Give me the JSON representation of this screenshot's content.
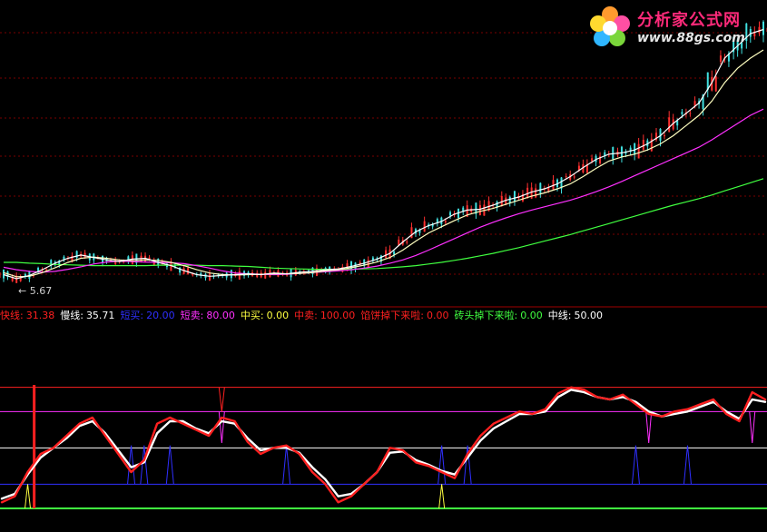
{
  "logo": {
    "brand": "分析家公式网",
    "url": "www.88gs.com"
  },
  "price_low_label": "← 5.67",
  "legend": [
    {
      "name": "快线",
      "value": "31.38",
      "color": "#ff2020"
    },
    {
      "name": "慢线",
      "value": "35.71",
      "color": "#ffffff"
    },
    {
      "name": "短买",
      "value": "20.00",
      "color": "#2f2fff"
    },
    {
      "name": "短卖",
      "value": "80.00",
      "color": "#ff30ff"
    },
    {
      "name": "中买",
      "value": "0.00",
      "color": "#ffff40"
    },
    {
      "name": "中卖",
      "value": "100.00",
      "color": "#ff2020"
    },
    {
      "name": "馅饼掉下来啦",
      "value": "0.00",
      "color": "#ff2020"
    },
    {
      "name": "砖头掉下来啦",
      "value": "0.00",
      "color": "#40ff40"
    },
    {
      "name": "中线",
      "value": "50.00",
      "color": "#ffffff"
    }
  ],
  "chart_data": [
    {
      "type": "line",
      "panel": "price",
      "x_count": 60,
      "series": [
        {
          "color": "#40ff40",
          "values": [
            6.3,
            6.3,
            6.28,
            6.27,
            6.25,
            6.24,
            6.23,
            6.22,
            6.22,
            6.22,
            6.22,
            6.22,
            6.23,
            6.23,
            6.23,
            6.23,
            6.22,
            6.22,
            6.21,
            6.2,
            6.18,
            6.16,
            6.15,
            6.14,
            6.13,
            6.13,
            6.13,
            6.13,
            6.14,
            6.15,
            6.17,
            6.19,
            6.22,
            6.26,
            6.3,
            6.35,
            6.4,
            6.46,
            6.52,
            6.59,
            6.66,
            6.74,
            6.82,
            6.9,
            6.98,
            7.07,
            7.16,
            7.25,
            7.34,
            7.43,
            7.52,
            7.61,
            7.7,
            7.78,
            7.86,
            7.95,
            8.05,
            8.15,
            8.25,
            8.35
          ]
        },
        {
          "color": "#ff30ff",
          "values": [
            6.18,
            6.12,
            6.08,
            6.06,
            6.08,
            6.13,
            6.19,
            6.26,
            6.31,
            6.33,
            6.32,
            6.31,
            6.3,
            6.29,
            6.27,
            6.22,
            6.16,
            6.09,
            6.04,
            6.02,
            6.01,
            6.0,
            6.01,
            6.03,
            6.05,
            6.07,
            6.09,
            6.12,
            6.16,
            6.21,
            6.28,
            6.36,
            6.47,
            6.6,
            6.74,
            6.88,
            7.02,
            7.16,
            7.28,
            7.39,
            7.49,
            7.58,
            7.66,
            7.74,
            7.82,
            7.92,
            8.03,
            8.15,
            8.28,
            8.42,
            8.56,
            8.7,
            8.84,
            8.98,
            9.12,
            9.3,
            9.5,
            9.7,
            9.9,
            10.05
          ]
        },
        {
          "color": "#ffffc0",
          "values": [
            6.05,
            5.95,
            5.96,
            6.05,
            6.17,
            6.3,
            6.4,
            6.43,
            6.4,
            6.36,
            6.34,
            6.36,
            6.35,
            6.3,
            6.22,
            6.12,
            6.04,
            6.0,
            5.99,
            6.0,
            6.01,
            6.02,
            6.02,
            6.03,
            6.05,
            6.09,
            6.12,
            6.17,
            6.23,
            6.31,
            6.42,
            6.6,
            6.82,
            7.02,
            7.17,
            7.32,
            7.46,
            7.55,
            7.62,
            7.72,
            7.82,
            7.92,
            8.0,
            8.1,
            8.22,
            8.4,
            8.6,
            8.78,
            8.88,
            8.95,
            9.05,
            9.2,
            9.4,
            9.65,
            9.9,
            10.25,
            10.7,
            11.05,
            11.3,
            11.5
          ]
        },
        {
          "color": "#ffffff",
          "values": [
            6.0,
            5.9,
            5.98,
            6.12,
            6.28,
            6.4,
            6.48,
            6.42,
            6.36,
            6.32,
            6.38,
            6.4,
            6.3,
            6.22,
            6.1,
            6.0,
            5.96,
            5.98,
            6.0,
            6.02,
            6.0,
            6.04,
            6.02,
            6.06,
            6.08,
            6.12,
            6.14,
            6.2,
            6.28,
            6.38,
            6.52,
            6.8,
            7.05,
            7.2,
            7.3,
            7.48,
            7.58,
            7.6,
            7.7,
            7.82,
            7.9,
            8.02,
            8.1,
            8.22,
            8.4,
            8.62,
            8.82,
            8.95,
            8.98,
            9.05,
            9.2,
            9.4,
            9.7,
            9.95,
            10.2,
            10.7,
            11.3,
            11.6,
            11.9,
            12.0
          ]
        }
      ],
      "ylim": [
        5.5,
        12.5
      ]
    },
    {
      "type": "line",
      "panel": "indicator",
      "x_count": 60,
      "series": [
        {
          "name": "快线",
          "color": "#ff2020",
          "values": [
            5,
            10,
            30,
            45,
            50,
            60,
            70,
            75,
            60,
            45,
            30,
            40,
            70,
            75,
            70,
            65,
            60,
            75,
            72,
            55,
            45,
            50,
            52,
            45,
            30,
            20,
            5,
            10,
            20,
            30,
            50,
            48,
            38,
            35,
            30,
            25,
            45,
            60,
            70,
            75,
            80,
            78,
            82,
            95,
            100,
            98,
            92,
            90,
            94,
            86,
            78,
            76,
            80,
            82,
            86,
            90,
            78,
            72,
            96,
            90
          ]
        },
        {
          "name": "慢线",
          "color": "#ffffff",
          "values": [
            8,
            12,
            28,
            42,
            50,
            58,
            68,
            72,
            62,
            48,
            34,
            38,
            62,
            72,
            72,
            66,
            62,
            72,
            70,
            58,
            48,
            50,
            50,
            46,
            34,
            24,
            10,
            12,
            20,
            30,
            46,
            47,
            40,
            36,
            31,
            28,
            42,
            56,
            66,
            72,
            78,
            78,
            80,
            92,
            98,
            96,
            92,
            90,
            92,
            88,
            80,
            76,
            78,
            80,
            84,
            88,
            80,
            74,
            90,
            88
          ]
        }
      ],
      "reference_lines": [
        {
          "name": "中卖",
          "value": 100,
          "color": "#ff2020"
        },
        {
          "name": "短卖",
          "value": 80,
          "color": "#ff30ff"
        },
        {
          "name": "中线",
          "value": 50,
          "color": "#ffffff"
        },
        {
          "name": "短买",
          "value": 20,
          "color": "#2f2fff"
        },
        {
          "name": "中买",
          "value": 0,
          "color": "#40ff40"
        }
      ],
      "ylim": [
        -15,
        150
      ]
    }
  ]
}
